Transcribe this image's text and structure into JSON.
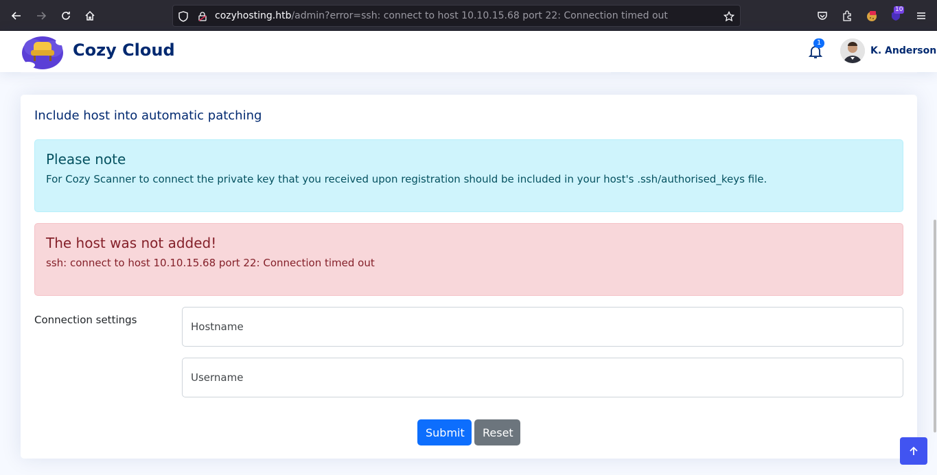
{
  "browser": {
    "url_host": "cozyhosting.htb",
    "url_path": "/admin?error=ssh: connect to host 10.10.15.68 port 22: Connection timed out",
    "extension_badge": "10",
    "icons": [
      "back-arrow-icon",
      "forward-arrow-icon",
      "reload-icon",
      "home-icon",
      "shield-icon",
      "lock-icon",
      "star-icon",
      "pocket-icon",
      "extensions-icon",
      "menu-icon"
    ]
  },
  "header": {
    "brand": "Cozy Cloud",
    "notification_count": "1",
    "user_name": "K. Anderson"
  },
  "card": {
    "title": "Include host into automatic patching",
    "info_alert": {
      "heading": "Please note",
      "text": "For Cozy Scanner to connect the private key that you received upon registration should be included in your host's .ssh/authorised_keys file."
    },
    "error_alert": {
      "heading": "The host was not added!",
      "text": "ssh: connect to host 10.10.15.68 port 22: Connection timed out"
    },
    "form": {
      "section_label": "Connection settings",
      "hostname_placeholder": "Hostname",
      "username_placeholder": "Username",
      "submit_label": "Submit",
      "reset_label": "Reset"
    }
  },
  "colors": {
    "brand": "#012970",
    "primary": "#0d6efd",
    "info_bg": "#cff4fc",
    "danger_bg": "#f8d7da",
    "back_to_top": "#4154f1"
  }
}
